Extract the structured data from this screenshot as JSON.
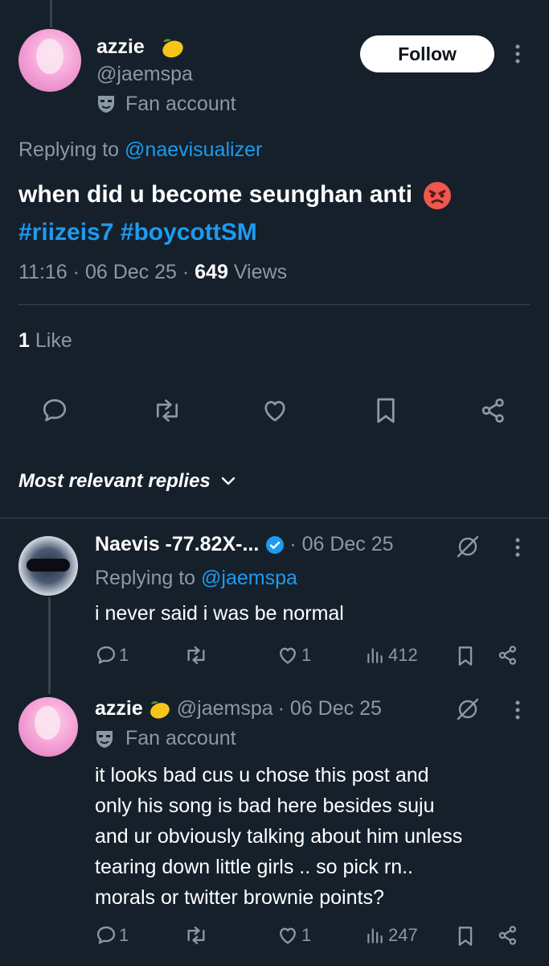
{
  "main_tweet": {
    "author_name": "azzie",
    "author_handle": "@jaemspa",
    "fan_label": "Fan account",
    "follow_label": "Follow",
    "replying_prefix": "Replying to",
    "replying_to": "@naevisualizer",
    "text": "when did u become seunghan anti",
    "hashtags": "#riizeis7 #boycottSM",
    "time": "11:16",
    "date": "06 Dec 25",
    "views_count": "649",
    "views_label": "Views",
    "likes_count": "1",
    "likes_label": "Like",
    "separator": "·"
  },
  "replies_header": {
    "label": "Most relevant replies"
  },
  "replies": [
    {
      "author_name": "Naevis -77.82X-...",
      "date": "· 06 Dec 25",
      "replying_prefix": "Replying to",
      "replying_to": "@jaemspa",
      "text": "i never said i was be normal",
      "reply_count": "1",
      "like_count": "1",
      "view_count": "412"
    },
    {
      "author_name": "azzie",
      "author_handle": "@jaemspa",
      "date": "· 06 Dec 25",
      "fan_label": "Fan account",
      "text_lines": [
        "it looks bad cus u chose this post and",
        "only his song is bad here besides suju",
        "and ur obviously talking about him unless",
        "tearing down little girls .. so pick rn..",
        "morals or twitter brownie points?"
      ],
      "reply_count": "1",
      "like_count": "1",
      "view_count": "247"
    }
  ],
  "colors": {
    "background": "#15202b",
    "link": "#1d9bf0",
    "muted": "#8b98a5",
    "verified": "#1d9bf0"
  }
}
